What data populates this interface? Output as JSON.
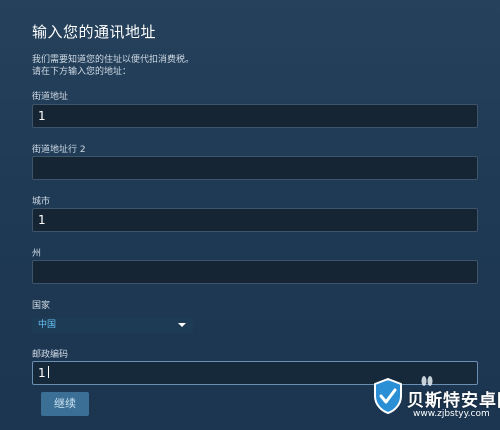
{
  "form": {
    "title": "输入您的通讯地址",
    "description_line1": "我们需要知道您的住址以便代扣消费税。",
    "description_line2": "请在下方输入您的地址：",
    "fields": [
      {
        "label": "街道地址",
        "value": "1"
      },
      {
        "label": "街道地址行 2",
        "value": ""
      },
      {
        "label": "城市",
        "value": "1"
      },
      {
        "label": "州",
        "value": ""
      }
    ],
    "country": {
      "label": "国家",
      "selected": "中国"
    },
    "postal": {
      "label": "邮政编码",
      "value": "1"
    },
    "submit_label": "继续"
  },
  "watermark": {
    "brand": "贝斯特安卓网",
    "url": "www.zjbstyy.com",
    "logo_icon": "shield-icon"
  },
  "colors": {
    "background": "#1f3a55",
    "input_background": "#152534",
    "select_text": "#67c1f5",
    "button": "#3b6f95"
  }
}
